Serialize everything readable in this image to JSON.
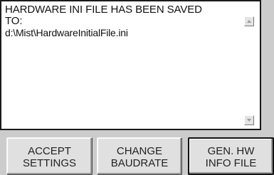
{
  "message": {
    "line1": "HARDWARE INI FILE HAS BEEN SAVED",
    "line2": "TO:",
    "path": "d:\\Mist\\HardwareInitialFile.ini"
  },
  "icons": {
    "scroll_up": "scroll-up-arrow",
    "scroll_down": "scroll-down-arrow"
  },
  "buttons": {
    "accept": "ACCEPT\nSETTINGS",
    "baudrate": "CHANGE\nBAUDRATE",
    "gen_hw": "GEN. HW\nINFO FILE"
  }
}
